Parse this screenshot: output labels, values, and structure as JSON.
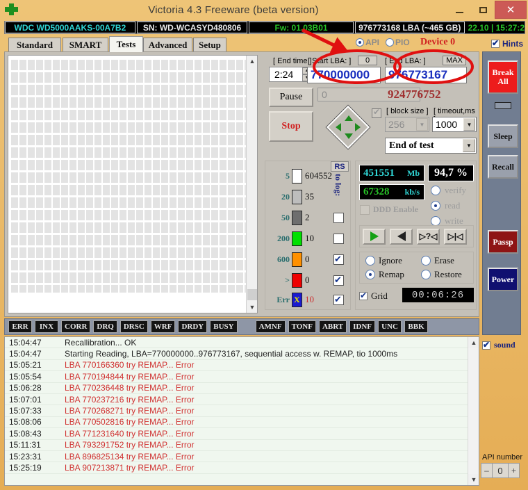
{
  "window": {
    "title": "Victoria 4.3 Freeware (beta version)",
    "minimize_label": "–",
    "maximize_label": "□",
    "close_label": "✕",
    "logo_icon": "green-cross-icon",
    "titlebar_color": "#e8b661",
    "close_color": "#cc5a56"
  },
  "drive_strip": {
    "model": "WDC WD5000AAKS-00A7B2",
    "serial": "SN: WD-WCASYD480806",
    "firmware": "Fw: 01.03B01",
    "capacity": "976773168 LBA (~465 GB)",
    "clock": "22.10 | 15:27:2",
    "model_color": "#2fd4d4",
    "firmware_color": "#27c327",
    "clock_color": "#27c327"
  },
  "tabs": [
    {
      "label": "Standard",
      "active": false
    },
    {
      "label": "SMART",
      "active": false
    },
    {
      "label": "Tests",
      "active": true
    },
    {
      "label": "Advanced",
      "active": false
    },
    {
      "label": "Setup",
      "active": false
    }
  ],
  "header_controls": {
    "api_label": "API",
    "api_selected": true,
    "pio_label": "PIO",
    "pio_selected": false,
    "device_label": "Device 0",
    "device_color": "#d02020",
    "hints_label": "Hints",
    "hints_checked": true
  },
  "test_panel": {
    "end_time_label": "[ End time ]",
    "end_time_value": "2:24",
    "start_lba_label": "[ Start LBA: ]",
    "start_lba_reset": "0",
    "start_lba_value": "770000000",
    "end_lba_label": "[ End LBA: ]",
    "end_lba_max": "MAX",
    "end_lba_value": "976773167",
    "pause_label": "Pause",
    "stop_label": "Stop",
    "current_lba_value": "0",
    "remaining_lba_value": "924776752",
    "block_size_label": "[ block size ]",
    "block_size_value": "256",
    "timeout_label": "[ timeout,ms ]",
    "timeout_value": "1000",
    "end_of_test_value": "End of test",
    "dpad_checked": true
  },
  "legend": {
    "rs_label": "RS",
    "to_log_label": "to log:",
    "rows": [
      {
        "threshold": "5",
        "color": "#ffffff",
        "count": "604552",
        "log": null
      },
      {
        "threshold": "20",
        "color": "#bdbdbd",
        "count": "35",
        "log": null
      },
      {
        "threshold": "50",
        "color": "#6e6e6e",
        "count": "2",
        "log": false
      },
      {
        "threshold": "200",
        "color": "#00e000",
        "count": "10",
        "log": false
      },
      {
        "threshold": "600",
        "color": "#ff9000",
        "count": "0",
        "log": true
      },
      {
        "threshold": ">",
        "color": "#ee0000",
        "count": "0",
        "log": true
      },
      {
        "threshold": "Err",
        "color": "#1a1ad0",
        "count": "10",
        "log": true
      }
    ]
  },
  "stats": {
    "megabytes_value": "451551",
    "megabytes_unit": "Mb",
    "percent_value": "94,7 %",
    "speed_value": "67328",
    "speed_unit": "kb/s",
    "ddd_label": "DDD Enable",
    "ddd_checked": false,
    "ops": [
      {
        "label": "verify",
        "selected": false
      },
      {
        "label": "read",
        "selected": true
      },
      {
        "label": "write",
        "selected": false
      }
    ],
    "nav_buttons": [
      {
        "name": "play-forward-button",
        "glyph": "▶"
      },
      {
        "name": "play-backward-button",
        "glyph": "◀"
      },
      {
        "name": "random-seek-button",
        "glyph": "▷?◁"
      },
      {
        "name": "butterfly-seek-button",
        "glyph": "▷|◁"
      }
    ],
    "modes": [
      {
        "label": "Ignore",
        "selected": false
      },
      {
        "label": "Remap",
        "selected": true
      },
      {
        "label": "Erase",
        "selected": false
      },
      {
        "label": "Restore",
        "selected": false
      }
    ],
    "grid_label": "Grid",
    "grid_checked": true,
    "timer_value": "00:06:26"
  },
  "status_registers": {
    "left": [
      "ERR",
      "INX",
      "CORR",
      "DRQ",
      "DRSC",
      "WRF",
      "DRDY",
      "BUSY"
    ],
    "right": [
      "AMNF",
      "TONF",
      "ABRT",
      "IDNF",
      "UNC",
      "BBK"
    ]
  },
  "log": [
    {
      "time": "15:04:47",
      "text": "Recallibration... OK",
      "error": false
    },
    {
      "time": "15:04:47",
      "text": "Starting Reading, LBA=770000000..976773167, sequential access w. REMAP, tio 1000ms",
      "error": false
    },
    {
      "time": "15:05:21",
      "text": "LBA 770166360 try REMAP... Error",
      "error": true
    },
    {
      "time": "15:05:54",
      "text": "LBA 770194844 try REMAP... Error",
      "error": true
    },
    {
      "time": "15:06:28",
      "text": "LBA 770236448 try REMAP... Error",
      "error": true
    },
    {
      "time": "15:07:01",
      "text": "LBA 770237216 try REMAP... Error",
      "error": true
    },
    {
      "time": "15:07:33",
      "text": "LBA 770268271 try REMAP... Error",
      "error": true
    },
    {
      "time": "15:08:06",
      "text": "LBA 770502816 try REMAP... Error",
      "error": true
    },
    {
      "time": "15:08:43",
      "text": "LBA 771231640 try REMAP... Error",
      "error": true
    },
    {
      "time": "15:11:31",
      "text": "LBA 793291752 try REMAP... Error",
      "error": true
    },
    {
      "time": "15:23:31",
      "text": "LBA 896825134 try REMAP... Error",
      "error": true
    },
    {
      "time": "15:25:19",
      "text": "LBA 907213871 try REMAP... Error",
      "error": true
    }
  ],
  "sidebar": {
    "break_all_label": "Break All",
    "break_all_line1": "Break",
    "break_all_line2": "All",
    "sleep_label": "Sleep",
    "recall_label": "Recall",
    "passp_label": "Passp",
    "power_label": "Power",
    "sound_label": "sound",
    "sound_checked": true,
    "api_number_label": "API number",
    "api_number_value": "0",
    "api_minus": "–",
    "api_plus": "+"
  },
  "annotations": {
    "arrow_color": "#e01010",
    "circle_color": "#e01010",
    "description": "red arrow from firmware field pointing to Start LBA field; two red ellipses around Start LBA and End LBA inputs"
  }
}
